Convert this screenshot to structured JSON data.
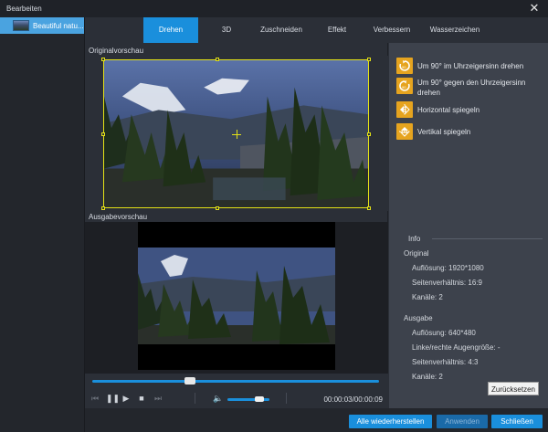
{
  "window": {
    "title": "Bearbeiten",
    "close_icon": "close-icon"
  },
  "sidebar": {
    "items": [
      {
        "label": "Beautiful natu..."
      }
    ]
  },
  "tabs": [
    {
      "label": "Drehen",
      "active": true
    },
    {
      "label": "3D"
    },
    {
      "label": "Zuschneiden"
    },
    {
      "label": "Effekt"
    },
    {
      "label": "Verbessern"
    },
    {
      "label": "Wasserzeichen"
    }
  ],
  "preview": {
    "original_label": "Originalvorschau",
    "output_label": "Ausgabevorschau"
  },
  "transport": {
    "time": "00:00:03/00:00:09",
    "progress": 0.34,
    "volume": 0.75,
    "icons": [
      "skip-back-icon",
      "pause-icon",
      "play-icon",
      "stop-icon",
      "skip-forward-icon",
      "volume-icon"
    ]
  },
  "rotate": {
    "items": [
      {
        "label": "Um 90° im Uhrzeigersinn drehen",
        "icon": "rotate-cw-icon"
      },
      {
        "label": "Um 90° gegen den Uhrzeigersinn drehen",
        "icon": "rotate-ccw-icon"
      },
      {
        "label": "Horizontal spiegeln",
        "icon": "flip-horizontal-icon"
      },
      {
        "label": "Vertikal spiegeln",
        "icon": "flip-vertical-icon"
      }
    ]
  },
  "info": {
    "title": "Info",
    "original": {
      "heading": "Original",
      "resolution": "Auflösung: 1920*1080",
      "aspect": "Seitenverhältnis: 16:9",
      "channels": "Kanäle: 2"
    },
    "output": {
      "heading": "Ausgabe",
      "resolution": "Auflösung: 640*480",
      "eye_size": "Linke/rechte Augengröße: -",
      "aspect": "Seitenverhältnis: 4:3",
      "channels": "Kanäle: 2"
    },
    "reset_label": "Zurücksetzen"
  },
  "footer": {
    "restore_all": "Alle wiederherstellen",
    "apply": "Anwenden",
    "close": "Schließen"
  },
  "colors": {
    "accent": "#1a8fdc",
    "crop_frame": "#e4e216",
    "rotate_icon_bg": "#e6a41f"
  }
}
